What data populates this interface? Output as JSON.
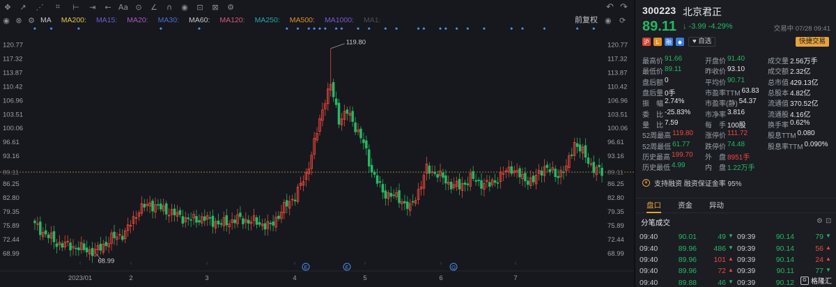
{
  "toolbar": {
    "icons": [
      "crosshair-icon",
      "cursor-icon",
      "trend-line-icon",
      "pattern-icon",
      "fib-icon",
      "measure-icon",
      "arrow-icon",
      "text-icon",
      "marker-icon",
      "ruler-icon",
      "magnet-icon",
      "eye-icon",
      "lock-icon",
      "delete-icon",
      "settings-icon"
    ],
    "glyphs": [
      "✥",
      "↗",
      "⋰",
      "⌗",
      "⊢",
      "⇥",
      "←",
      "Aa",
      "⊙",
      "∠",
      "∩",
      "◉",
      "⊡",
      "⊠",
      "⚙"
    ],
    "undo": "↶",
    "redo": "↷",
    "right_eye": "◉",
    "right_refresh": "⟳"
  },
  "indicators": {
    "eye": "◉",
    "close": "⊗",
    "settings": "⚙",
    "items": [
      {
        "label": "MA",
        "color": "#c6c9d0"
      },
      {
        "label": "MA200:",
        "color": "#e6c84a"
      },
      {
        "label": "MA15:",
        "color": "#6d5fd6"
      },
      {
        "label": "MA20:",
        "color": "#b055c8"
      },
      {
        "label": "MA30:",
        "color": "#4f6bd6"
      },
      {
        "label": "MA60:",
        "color": "#c8c8c8"
      },
      {
        "label": "MA120:",
        "color": "#d25a78"
      },
      {
        "label": "MA250:",
        "color": "#27a8a8"
      },
      {
        "label": "MA500:",
        "color": "#e0902a"
      },
      {
        "label": "MA1000:",
        "color": "#7a58d8"
      },
      {
        "label": "MA1:",
        "color": "#4a4f58"
      }
    ],
    "fuquan": "前复权"
  },
  "chart_data": {
    "type": "candlestick",
    "y_ticks": [
      "120.77",
      "117.32",
      "113.87",
      "110.42",
      "106.96",
      "103.51",
      "100.06",
      "96.61",
      "93.16",
      "89.11",
      "86.25",
      "82.80",
      "79.35",
      "75.89",
      "72.44",
      "68.99"
    ],
    "x_ticks": [
      "2023/01",
      "2",
      "3",
      "4",
      "5",
      "6",
      "7"
    ],
    "current_price": "89.11",
    "high_annotation": "119.80",
    "low_annotation": "68.99",
    "event_markers": [
      "E",
      "E",
      "Q"
    ],
    "colors": {
      "up": "#f0483d",
      "down": "#25b863",
      "grid": "#22252b",
      "axis_text": "#9aa0a9",
      "dots": "#4f8ff0",
      "price_line": "#e8a23a"
    }
  },
  "stock": {
    "code": "300223",
    "name": "北京君正",
    "price": "89.11",
    "change": "↓ -3.99 -4.29%",
    "status": "交易中 07/28 09:41",
    "tags": [
      {
        "t": "沪",
        "c": "#d6453a"
      },
      {
        "t": "L",
        "c": "#e0902a"
      },
      {
        "t": "融",
        "c": "#3a7be0"
      },
      {
        "t": "◆",
        "c": "#3a7be0"
      }
    ],
    "zixuan": "♥ 自选",
    "kuaijie": "快捷交易"
  },
  "stats": [
    [
      {
        "l": "最高价",
        "v": "91.66",
        "c": "green"
      },
      {
        "l": "开盘价",
        "v": "91.40",
        "c": "green"
      },
      {
        "l": "成交量",
        "v": "2.56万手",
        "c": ""
      }
    ],
    [
      {
        "l": "最低价",
        "v": "89.11",
        "c": "green"
      },
      {
        "l": "昨收价",
        "v": "93.10",
        "c": ""
      },
      {
        "l": "成交额",
        "v": "2.32亿",
        "c": ""
      }
    ],
    [
      {
        "l": "盘后额",
        "v": "0",
        "c": ""
      },
      {
        "l": "平均价",
        "v": "90.71",
        "c": "green"
      },
      {
        "l": "总市值",
        "v": "429.13亿",
        "c": ""
      }
    ],
    [
      {
        "l": "盘后量",
        "v": "0手",
        "c": ""
      },
      {
        "l": "市盈率TTM",
        "v": "63.83",
        "c": ""
      },
      {
        "l": "总股本",
        "v": "4.82亿",
        "c": ""
      }
    ],
    [
      {
        "l": "振　幅",
        "v": "2.74%",
        "c": ""
      },
      {
        "l": "市盈率(静)",
        "v": "54.37",
        "c": ""
      },
      {
        "l": "流通值",
        "v": "370.52亿",
        "c": ""
      }
    ],
    [
      {
        "l": "委　比",
        "v": "-25.83%",
        "c": ""
      },
      {
        "l": "市净率",
        "v": "3.816",
        "c": ""
      },
      {
        "l": "流通股",
        "v": "4.16亿",
        "c": ""
      }
    ],
    [
      {
        "l": "量　比",
        "v": "7.59",
        "c": ""
      },
      {
        "l": "每　手",
        "v": "100股",
        "c": ""
      },
      {
        "l": "换手率",
        "v": "0.62%",
        "c": ""
      }
    ],
    [
      {
        "l": "52周最高",
        "v": "119.80",
        "c": "red"
      },
      {
        "l": "涨停价",
        "v": "111.72",
        "c": "red"
      },
      {
        "l": "股息TTM",
        "v": "0.080",
        "c": ""
      }
    ],
    [
      {
        "l": "52周最低",
        "v": "61.77",
        "c": "green"
      },
      {
        "l": "跌停价",
        "v": "74.48",
        "c": "green"
      },
      {
        "l": "股息率TTM",
        "v": "0.090%",
        "c": ""
      }
    ],
    [
      {
        "l": "历史最高",
        "v": "199.70",
        "c": "red"
      },
      {
        "l": "外　盘",
        "v": "8951手",
        "c": "red"
      },
      {
        "l": "",
        "v": "",
        "c": ""
      }
    ],
    [
      {
        "l": "历史最低",
        "v": "4.99",
        "c": "green"
      },
      {
        "l": "内　盘",
        "v": "1.22万手",
        "c": "green"
      },
      {
        "l": "",
        "v": "",
        "c": ""
      }
    ]
  ],
  "notice": {
    "icon": "¥",
    "text": "支持融资 融资保证金率 95%"
  },
  "tabs": [
    "盘口",
    "资金",
    "异动"
  ],
  "ticks_title": "分笔成交",
  "ticks": [
    [
      {
        "t": "09:40",
        "p": "90.01",
        "pc": "green",
        "v": "49",
        "vc": "green",
        "a": "▼",
        "ac": "green"
      },
      {
        "t": "09:39",
        "p": "90.14",
        "pc": "green",
        "v": "79",
        "vc": "green",
        "a": "▼",
        "ac": "green"
      }
    ],
    [
      {
        "t": "09:40",
        "p": "89.96",
        "pc": "green",
        "v": "486",
        "vc": "green",
        "a": "▼",
        "ac": "green"
      },
      {
        "t": "09:39",
        "p": "90.14",
        "pc": "green",
        "v": "56",
        "vc": "red",
        "a": "▲",
        "ac": "red"
      }
    ],
    [
      {
        "t": "09:40",
        "p": "89.96",
        "pc": "green",
        "v": "101",
        "vc": "red",
        "a": "▲",
        "ac": "red"
      },
      {
        "t": "09:39",
        "p": "90.14",
        "pc": "green",
        "v": "24",
        "vc": "red",
        "a": "▲",
        "ac": "red"
      }
    ],
    [
      {
        "t": "09:40",
        "p": "89.96",
        "pc": "green",
        "v": "72",
        "vc": "red",
        "a": "▲",
        "ac": "red"
      },
      {
        "t": "09:39",
        "p": "90.11",
        "pc": "green",
        "v": "77",
        "vc": "green",
        "a": "▼",
        "ac": "green"
      }
    ],
    [
      {
        "t": "09:40",
        "p": "89.88",
        "pc": "green",
        "v": "46",
        "vc": "green",
        "a": "▼",
        "ac": "green"
      },
      {
        "t": "09:39",
        "p": "90.12",
        "pc": "green",
        "v": "",
        "vc": "green",
        "a": "",
        "ac": "green"
      }
    ]
  ],
  "watermark": "格隆汇"
}
